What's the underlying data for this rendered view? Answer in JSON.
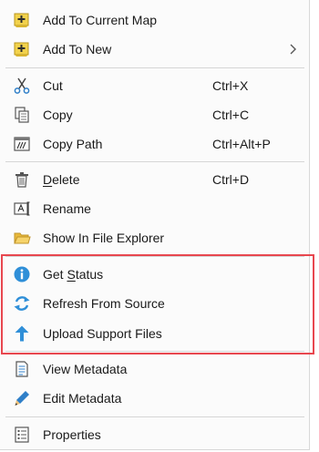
{
  "menu": {
    "items": [
      {
        "label": "Add To Current Map",
        "shortcut": "",
        "icon": "add-layer-icon"
      },
      {
        "label": "Add To New",
        "shortcut": "",
        "icon": "add-layer-icon",
        "submenu": true
      },
      {
        "label": "Cut",
        "shortcut": "Ctrl+X",
        "icon": "scissors-icon"
      },
      {
        "label": "Copy",
        "shortcut": "Ctrl+C",
        "icon": "copy-icon"
      },
      {
        "label": "Copy Path",
        "shortcut": "Ctrl+Alt+P",
        "icon": "copy-path-icon"
      },
      {
        "label_pre": "",
        "label_u": "D",
        "label_post": "elete",
        "shortcut": "Ctrl+D",
        "icon": "trash-icon"
      },
      {
        "label": "Rename",
        "shortcut": "",
        "icon": "rename-icon"
      },
      {
        "label": "Show In File Explorer",
        "shortcut": "",
        "icon": "folder-icon"
      },
      {
        "label_pre": "Get ",
        "label_u": "S",
        "label_post": "tatus",
        "shortcut": "",
        "icon": "info-icon"
      },
      {
        "label": "Refresh From Source",
        "shortcut": "",
        "icon": "refresh-icon"
      },
      {
        "label": "Upload Support Files",
        "shortcut": "",
        "icon": "upload-arrow-icon"
      },
      {
        "label": "View Metadata",
        "shortcut": "",
        "icon": "metadata-icon"
      },
      {
        "label": "Edit Metadata",
        "shortcut": "",
        "icon": "pencil-icon"
      },
      {
        "label": "Properties",
        "shortcut": "",
        "icon": "properties-icon"
      }
    ]
  },
  "colors": {
    "highlight_border": "#e8474f",
    "accent_blue": "#2f8fd8",
    "folder_yellow": "#f2c94c"
  }
}
